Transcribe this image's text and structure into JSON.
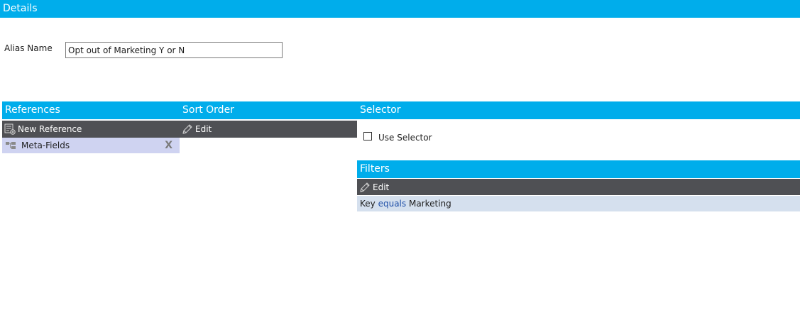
{
  "details": {
    "title": "Details",
    "alias_label": "Alias Name",
    "alias_value": "Opt out of Marketing Y or N"
  },
  "references": {
    "title": "References",
    "new_label": "New Reference",
    "items": [
      {
        "label": "Meta-Fields",
        "remove": "X",
        "icon": "hierarchy-icon"
      }
    ]
  },
  "sort_order": {
    "title": "Sort Order",
    "edit_label": "Edit"
  },
  "selector": {
    "title": "Selector",
    "use_label": "Use Selector",
    "checked": false
  },
  "filters": {
    "title": "Filters",
    "edit_label": "Edit",
    "rule": {
      "key": "Key",
      "operator": "equals",
      "value": "Marketing"
    }
  },
  "colors": {
    "header_blue": "#00adeb",
    "toolbar_gray": "#4f5054",
    "selected_row": "#cfd3f1",
    "filter_row": "#d5e0ee",
    "operator_blue": "#1f4fa8"
  }
}
